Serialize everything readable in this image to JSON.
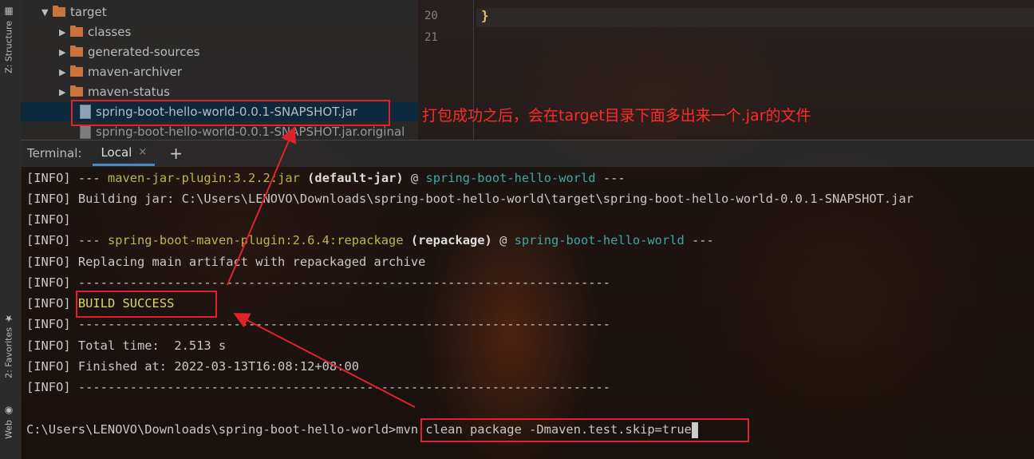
{
  "sidebar": {
    "structure_label": "Z: Structure",
    "favorites_label": "2: Favorites",
    "web_label": "Web"
  },
  "project_tree": {
    "items": [
      {
        "name": "target",
        "type": "folder",
        "expanded": true
      },
      {
        "name": "classes",
        "type": "folder",
        "expanded": false
      },
      {
        "name": "generated-sources",
        "type": "folder",
        "expanded": false
      },
      {
        "name": "maven-archiver",
        "type": "folder",
        "expanded": false
      },
      {
        "name": "maven-status",
        "type": "folder",
        "expanded": false
      },
      {
        "name": "spring-boot-hello-world-0.0.1-SNAPSHOT.jar",
        "type": "jar",
        "selected": true
      },
      {
        "name": "spring-boot-hello-world-0.0.1-SNAPSHOT.jar.original",
        "type": "file"
      }
    ]
  },
  "editor": {
    "line_numbers": [
      "20",
      "21"
    ],
    "line20_code": "}"
  },
  "terminal_header": {
    "label": "Terminal:",
    "tab": "Local",
    "close_glyph": "×",
    "add_glyph": "+"
  },
  "terminal": {
    "info_tag": "[INFO]",
    "l1_prefix": " --- ",
    "l1_plugin": "maven-jar-plugin:3.2.2:jar",
    "l1_goal": "(default-jar)",
    "l1_at": " @ ",
    "l1_project": "spring-boot-hello-world",
    "l1_suffix": " ---",
    "l2_text": " Building jar: C:\\Users\\LENOVO\\Downloads\\spring-boot-hello-world\\target\\spring-boot-hello-world-0.0.1-SNAPSHOT.jar",
    "l4_prefix": " --- ",
    "l4_plugin": "spring-boot-maven-plugin:2.6.4:repackage",
    "l4_goal": "(repackage)",
    "l4_at": " @ ",
    "l4_project": "spring-boot-hello-world",
    "l4_suffix": " ---",
    "l5_text": " Replacing main artifact with repackaged archive",
    "separator": " ------------------------------------------------------------------------",
    "build_success": "BUILD SUCCESS",
    "total_time": " Total time:  2.513 s",
    "finished_at": " Finished at: 2022-03-13T16:08:12+08:00",
    "prompt_path": "C:\\Users\\LENOVO\\Downloads\\spring-boot-hello-world>",
    "command": "mvn clean package -Dmaven.test.skip=true"
  },
  "annotation": {
    "text": "打包成功之后，会在target目录下面多出来一个.jar的文件"
  },
  "colors": {
    "annotation_red": "#e0232a",
    "plugin_yellow": "#b8b84a",
    "project_teal": "#3fa5a5",
    "folder_orange": "#c8743c"
  }
}
